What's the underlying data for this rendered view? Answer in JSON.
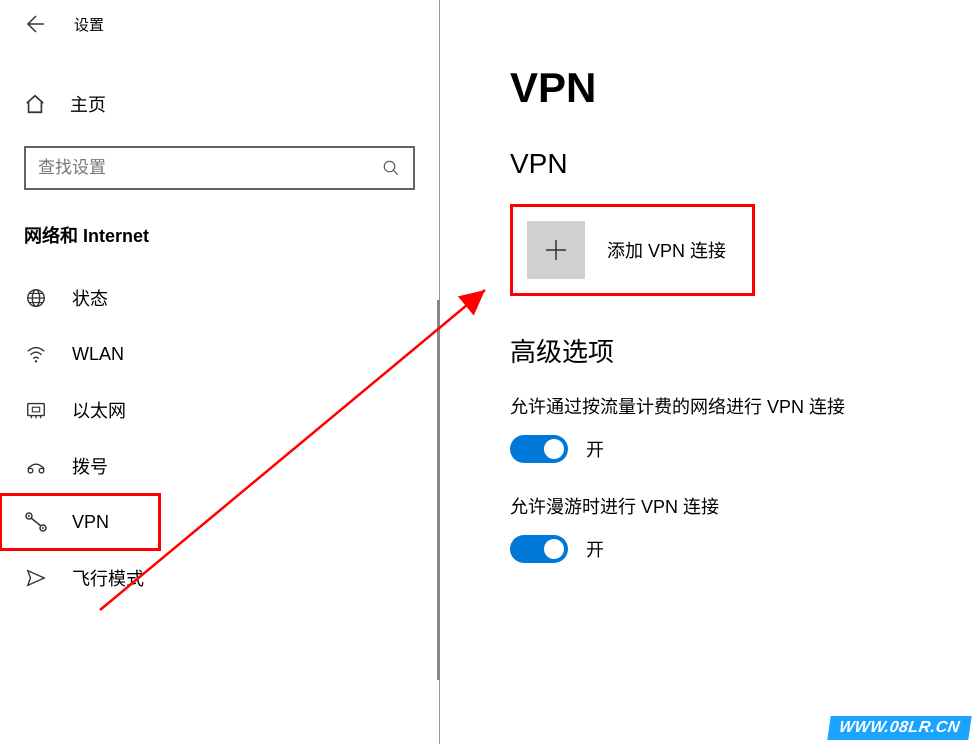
{
  "header": {
    "title": "设置"
  },
  "sidebar": {
    "home_label": "主页",
    "search_placeholder": "查找设置",
    "category": "网络和 Internet",
    "items": [
      {
        "icon": "globe",
        "label": "状态"
      },
      {
        "icon": "wifi",
        "label": "WLAN"
      },
      {
        "icon": "ethernet",
        "label": "以太网"
      },
      {
        "icon": "dialup",
        "label": "拨号"
      },
      {
        "icon": "vpn",
        "label": "VPN",
        "selected": true
      },
      {
        "icon": "airplane",
        "label": "飞行模式"
      }
    ]
  },
  "main": {
    "page_title": "VPN",
    "section_vpn": "VPN",
    "add_vpn_label": "添加 VPN 连接",
    "section_advanced": "高级选项",
    "options": [
      {
        "label": "允许通过按流量计费的网络进行 VPN 连接",
        "state": "开",
        "on": true
      },
      {
        "label": "允许漫游时进行 VPN 连接",
        "state": "开",
        "on": true
      }
    ]
  },
  "watermark": "WWW.08LR.CN"
}
